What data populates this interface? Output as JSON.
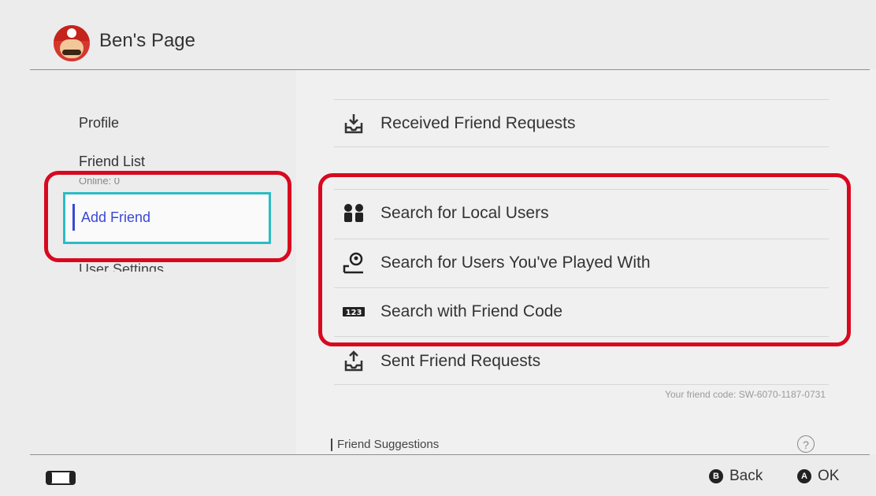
{
  "header": {
    "title": "Ben's Page",
    "avatar_icon": "mario-avatar-icon"
  },
  "sidebar": {
    "items": [
      {
        "label": "Profile"
      },
      {
        "label": "Friend List",
        "sub": "Online: 0"
      },
      {
        "label": "Add Friend",
        "selected": true
      },
      {
        "label": "User Settings"
      }
    ]
  },
  "main": {
    "rows": [
      {
        "label": "Received Friend Requests",
        "icon": "inbox-download-icon"
      },
      {
        "label": "Search for Local Users",
        "icon": "local-users-icon"
      },
      {
        "label": "Search for Users You've Played With",
        "icon": "played-with-icon"
      },
      {
        "label": "Search with Friend Code",
        "icon": "friend-code-123-icon"
      },
      {
        "label": "Sent Friend Requests",
        "icon": "outbox-upload-icon"
      }
    ],
    "friend_code_text": "Your friend code: SW-6070-1187-0731",
    "suggestions_label": "Friend Suggestions",
    "help_glyph": "?"
  },
  "footer": {
    "back_glyph": "B",
    "back_label": "Back",
    "ok_glyph": "A",
    "ok_label": "OK"
  },
  "colors": {
    "highlight": "#d8091f",
    "selection_border": "#2bbcc4",
    "selection_text": "#3a48d6"
  }
}
